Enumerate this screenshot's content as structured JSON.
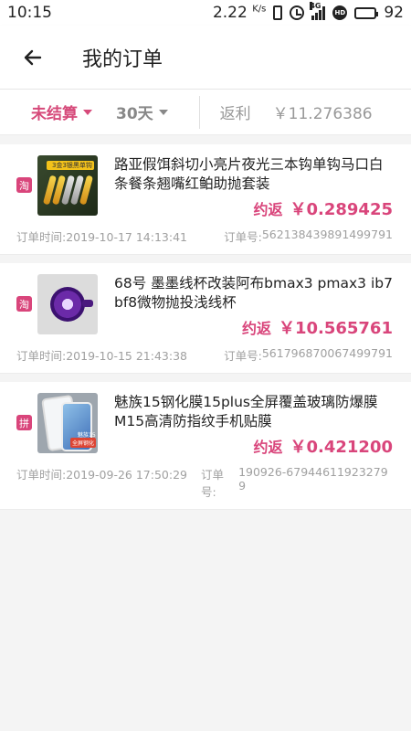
{
  "status": {
    "time": "10:15",
    "network_speed": "2.22",
    "network_unit": "K/s",
    "network_type": "4G",
    "hd_label": "HD",
    "battery": "92"
  },
  "header": {
    "title": "我的订单",
    "back_icon": "arrow-left-icon"
  },
  "filters": {
    "status_label": "未结算",
    "period_label": "30天",
    "rebate_label": "返利",
    "rebate_value": "￥11.276386",
    "accent_color": "#d64a7a"
  },
  "orders": [
    {
      "platform": "淘",
      "title": "路亚假饵斜切小亮片夜光三本钩单钩马口白条餐条翘嘴红鲌助抛套装",
      "thumb_text": "3金3银黑单钩",
      "rebate_label": "约返",
      "rebate_amount": "￥0.289425",
      "time_label": "订单时间:",
      "time": "2019-10-17 14:13:41",
      "no_label": "订单号:",
      "order_no": "562138439891499791"
    },
    {
      "platform": "淘",
      "title": "68号 墨墨线杯改装阿布bmax3 pmax3 ib7 bf8微物抛投浅线杯",
      "rebate_label": "约返",
      "rebate_amount": "￥10.565761",
      "time_label": "订单时间:",
      "time": "2019-10-15 21:43:38",
      "no_label": "订单号:",
      "order_no": "561796870067499791"
    },
    {
      "platform": "拼",
      "title": "魅族15钢化膜15plus全屏覆盖玻璃防爆膜M15高清防指纹手机贴膜",
      "thumb_brand": "魅族15",
      "thumb_tag": "全屏钢化",
      "rebate_label": "约返",
      "rebate_amount": "￥0.421200",
      "time_label": "订单时间:",
      "time": "2019-09-26 17:50:29",
      "no_label": "订单号:",
      "order_no": "190926-679446119232799"
    }
  ]
}
